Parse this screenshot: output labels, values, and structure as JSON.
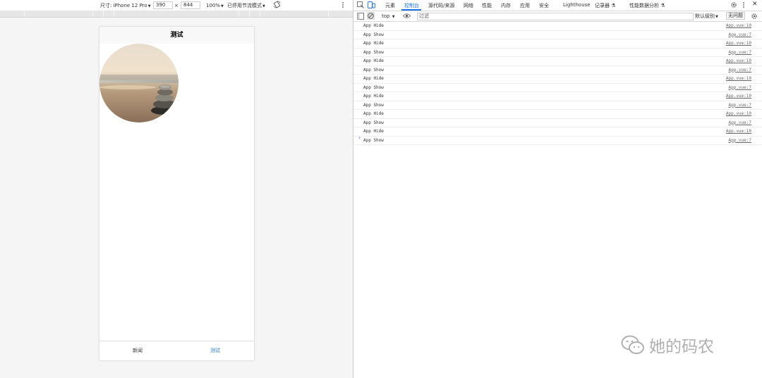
{
  "device_toolbar": {
    "dimensions_label": "尺寸: iPhone 12 Pro",
    "width_value": "390",
    "times_sign": "×",
    "height_value": "844",
    "zoom": "100%",
    "throttle": "已停用节流模式"
  },
  "phone": {
    "nav_title": "测试",
    "tabs": [
      {
        "label": "新闻",
        "active": false
      },
      {
        "label": "测试",
        "active": true
      }
    ]
  },
  "devtools": {
    "tabs": [
      "元素",
      "控制台",
      "源代码/来源",
      "网络",
      "性能",
      "内存",
      "应用",
      "安全",
      "Lighthouse",
      "记录器",
      "性能数据分析"
    ],
    "active_tab": "控制台",
    "context": "top",
    "filter_placeholder": "过滤",
    "levels": "默认级别",
    "issues": "无问题",
    "logs": [
      {
        "msg": "App Hide",
        "src": "App.vue:10"
      },
      {
        "msg": "App Show",
        "src": "App.vue:7"
      },
      {
        "msg": "App Hide",
        "src": "App.vue:10"
      },
      {
        "msg": "App Show",
        "src": "App.vue:7"
      },
      {
        "msg": "App Hide",
        "src": "App.vue:10"
      },
      {
        "msg": "App Show",
        "src": "App.vue:7"
      },
      {
        "msg": "App Hide",
        "src": "App.vue:10"
      },
      {
        "msg": "App Show",
        "src": "App.vue:7"
      },
      {
        "msg": "App Hide",
        "src": "App.vue:10"
      },
      {
        "msg": "App Show",
        "src": "App.vue:7"
      },
      {
        "msg": "App Hide",
        "src": "App.vue:10"
      },
      {
        "msg": "App Show",
        "src": "App.vue:7"
      },
      {
        "msg": "App Hide",
        "src": "App.vue:10"
      },
      {
        "msg": "App Show",
        "src": "App.vue:7"
      }
    ],
    "prompt_symbol": "›"
  },
  "watermark": "她的码农",
  "colors": {
    "accent": "#1a73e8",
    "tab_active": "#2a7bd9"
  }
}
